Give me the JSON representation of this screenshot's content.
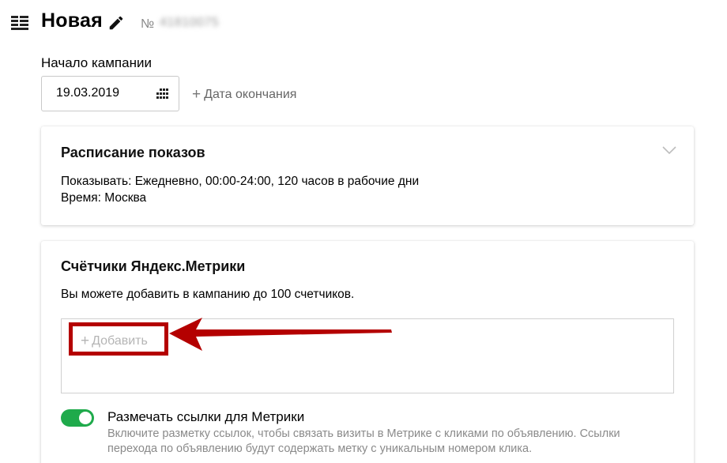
{
  "header": {
    "title": "Новая",
    "number_label": "№",
    "number_value": "41810075"
  },
  "campaign_start": {
    "label": "Начало кампании",
    "date_value": "19.03.2019",
    "end_date_label": "Дата окончания"
  },
  "schedule": {
    "title": "Расписание показов",
    "show_line": "Показывать: Ежедневно, 00:00-24:00, 120 часов в рабочие дни",
    "time_line": "Время: Москва"
  },
  "metrica": {
    "title": "Счётчики Яндекс.Метрики",
    "description": "Вы можете добавить в кампанию до 100 счетчиков.",
    "add_label": "Добавить",
    "toggle_label": "Размечать ссылки для Метрики",
    "toggle_on": true,
    "hint_line1": "Включите разметку ссылок, чтобы связать визиты в Метрике с кликами по объявлению. Ссылки",
    "hint_line2": "перехода по объявлению будут содержать метку с уникальным номером клика."
  },
  "icons": {
    "menu": "menu-icon",
    "edit": "pencil-icon",
    "calendar": "calendar-icon",
    "chevron": "chevron-down-icon",
    "annotation": "red-arrow"
  },
  "colors": {
    "toggle_on": "#1faa4b",
    "annotation_red": "#b40000"
  }
}
